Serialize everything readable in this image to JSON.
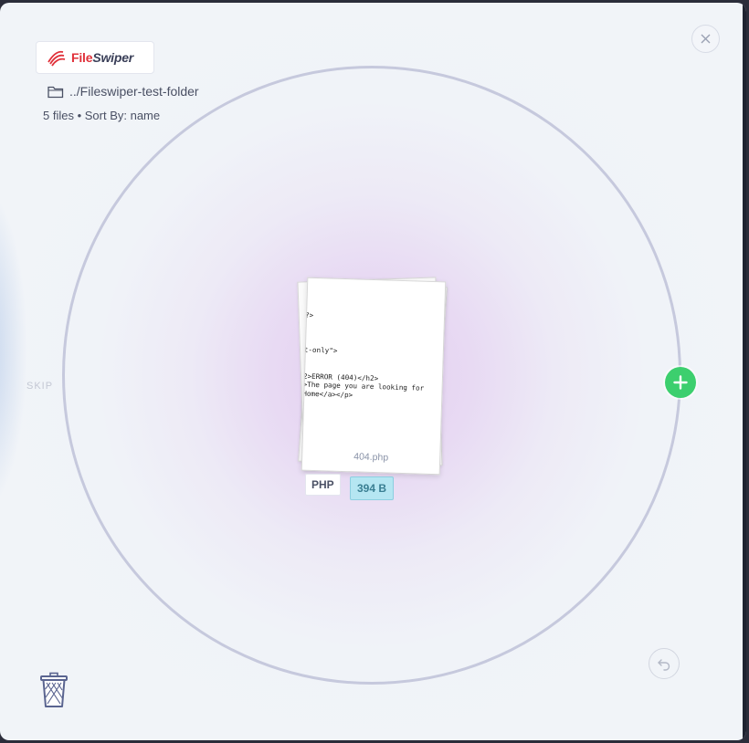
{
  "app": {
    "brand_prefix": "File",
    "brand_suffix": "Swiper"
  },
  "folder": {
    "path": "../Fileswiper-test-folder",
    "icon": "folder-icon"
  },
  "meta": {
    "summary": "5 files • Sort By: name"
  },
  "actions": {
    "skip_label": "SKIP",
    "add_icon": "plus-icon",
    "undo_icon": "undo-icon",
    "trash_icon": "trash-icon",
    "close_icon": "close-icon"
  },
  "card": {
    "filename": "404.php",
    "type": "PHP",
    "size": "394 B",
    "preview_lines": [
      "?>",
      "",
      "",
      "",
      "t-only\">",
      "",
      "",
      "2>ERROR (404)</h2>",
      ">The page you are looking for",
      "Home</a></p>"
    ]
  },
  "colors": {
    "accent_add": "#3ccf6e",
    "brand_red": "#e0313a",
    "ring": "#c6c9dd",
    "size_badge": "#b5e6f2"
  }
}
